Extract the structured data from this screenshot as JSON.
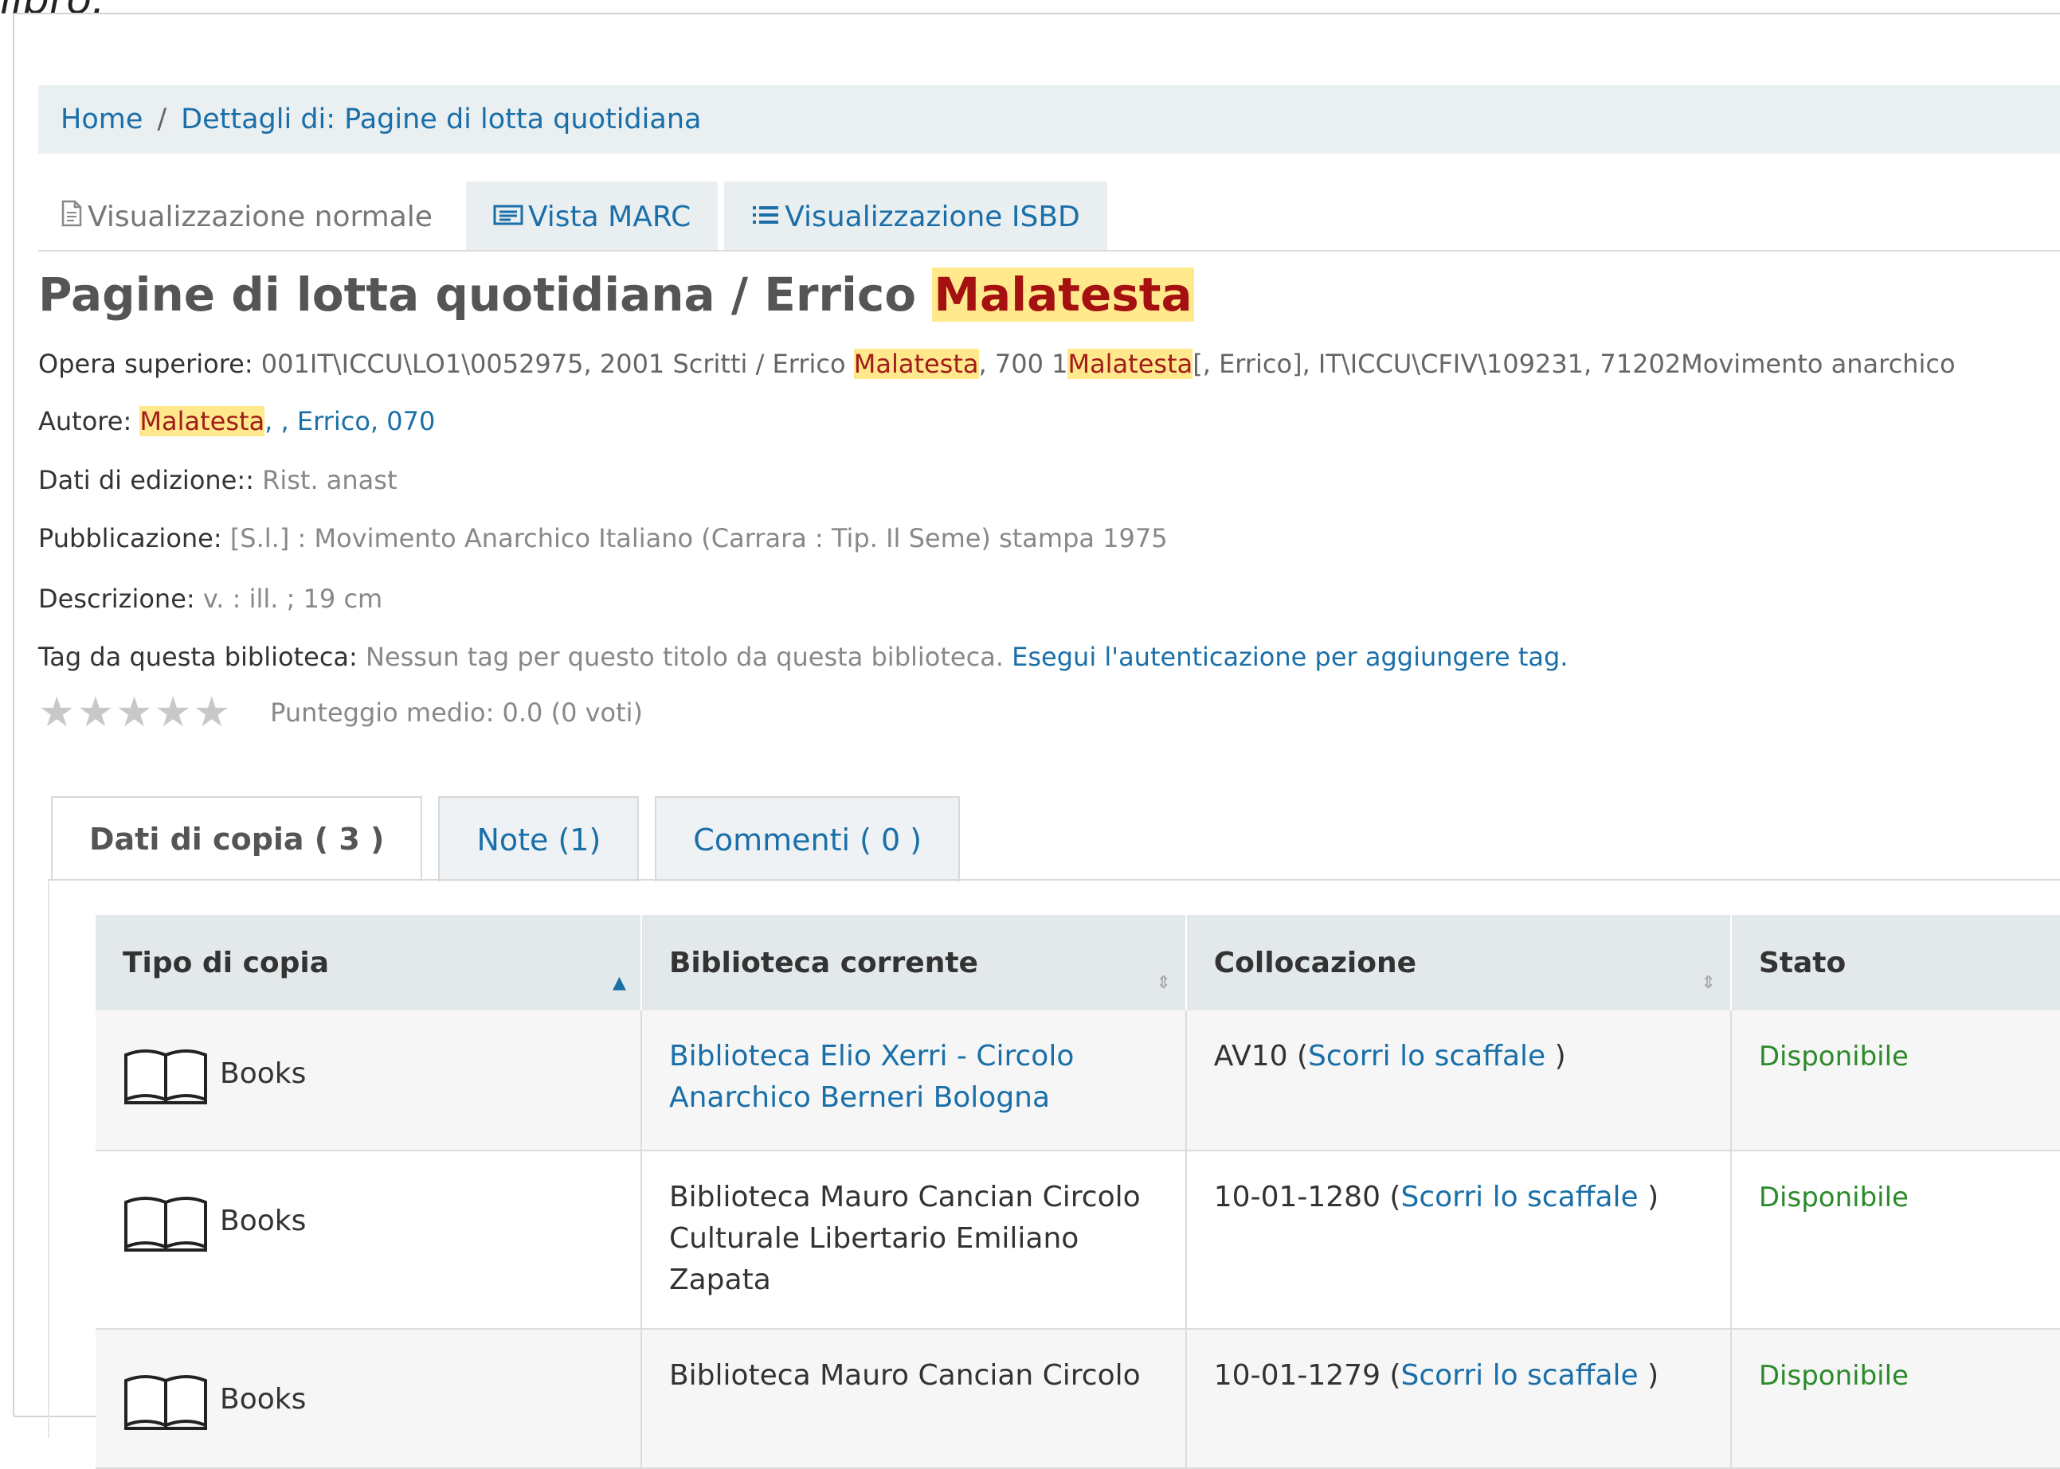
{
  "top_fragment": "libro.",
  "breadcrumb": {
    "home": "Home",
    "separator": "/",
    "current": "Dettagli di: Pagine di lotta quotidiana"
  },
  "view_tabs": [
    {
      "label": "Visualizzazione normale",
      "icon": "document-icon"
    },
    {
      "label": "Vista MARC",
      "icon": "marc-card-icon"
    },
    {
      "label": "Visualizzazione ISBD",
      "icon": "list-icon"
    }
  ],
  "title": {
    "main": "Pagine di lotta quotidiana / Errico ",
    "highlight": "Malatesta"
  },
  "details": {
    "opera": {
      "label": "Opera superiore:",
      "part1": " 001IT\\ICCU\\LO1\\0052975, 2001 Scritti / Errico ",
      "hl1": "Malatesta",
      "part2": ", 700 1",
      "hl2": "Malatesta",
      "part3": "[, Errico], IT\\ICCU\\CFIV\\109231, 71202Movimento anarchico"
    },
    "autore": {
      "label": "Autore:",
      "highlight": "Malatesta",
      "rest": ", , Errico, 070"
    },
    "edizione": {
      "label": "Dati di edizione::",
      "value": " Rist. anast"
    },
    "pubblicazione": {
      "label": "Pubblicazione:",
      "value": " [S.l.] : Movimento Anarchico Italiano (Carrara : Tip. Il Seme) stampa 1975"
    },
    "descrizione": {
      "label": "Descrizione:",
      "value": " v. : ill. ; 19 cm"
    },
    "tag": {
      "label": "Tag da questa biblioteca:",
      "value": " Nessun tag per questo titolo da questa biblioteca. ",
      "link": "Esegui l'autenticazione per aggiungere tag."
    }
  },
  "rating": {
    "stars": 5,
    "filled": 0,
    "text": "Punteggio medio: 0.0 (0 voti)"
  },
  "detail_tabs": [
    "Dati di copia ( 3 )",
    "Note (1)",
    "Commenti ( 0 )"
  ],
  "holdings": {
    "columns": [
      "Tipo di copia",
      "Biblioteca corrente",
      "Collocazione",
      "Stato"
    ],
    "rows": [
      {
        "type": "Books",
        "library": "Biblioteca Elio Xerri - Circolo Anarchico Berneri Bologna",
        "library_link": true,
        "callnumber": "AV10",
        "browse": "Scorri lo scaffale",
        "status": "Disponibile"
      },
      {
        "type": "Books",
        "library": "Biblioteca Mauro Cancian Circolo Culturale Libertario Emiliano Zapata",
        "library_link": false,
        "callnumber": "10-01-1280",
        "browse": "Scorri lo scaffale",
        "status": "Disponibile"
      },
      {
        "type": "Books",
        "library": "Biblioteca Mauro Cancian Circolo",
        "library_link": false,
        "callnumber": "10-01-1279",
        "browse": "Scorri lo scaffale",
        "status": "Disponibile"
      }
    ]
  },
  "colors": {
    "link": "#1a6fa8",
    "highlight_bg": "#ffe98c",
    "highlight_text": "#a21b1b",
    "available": "#2b8a2b"
  }
}
